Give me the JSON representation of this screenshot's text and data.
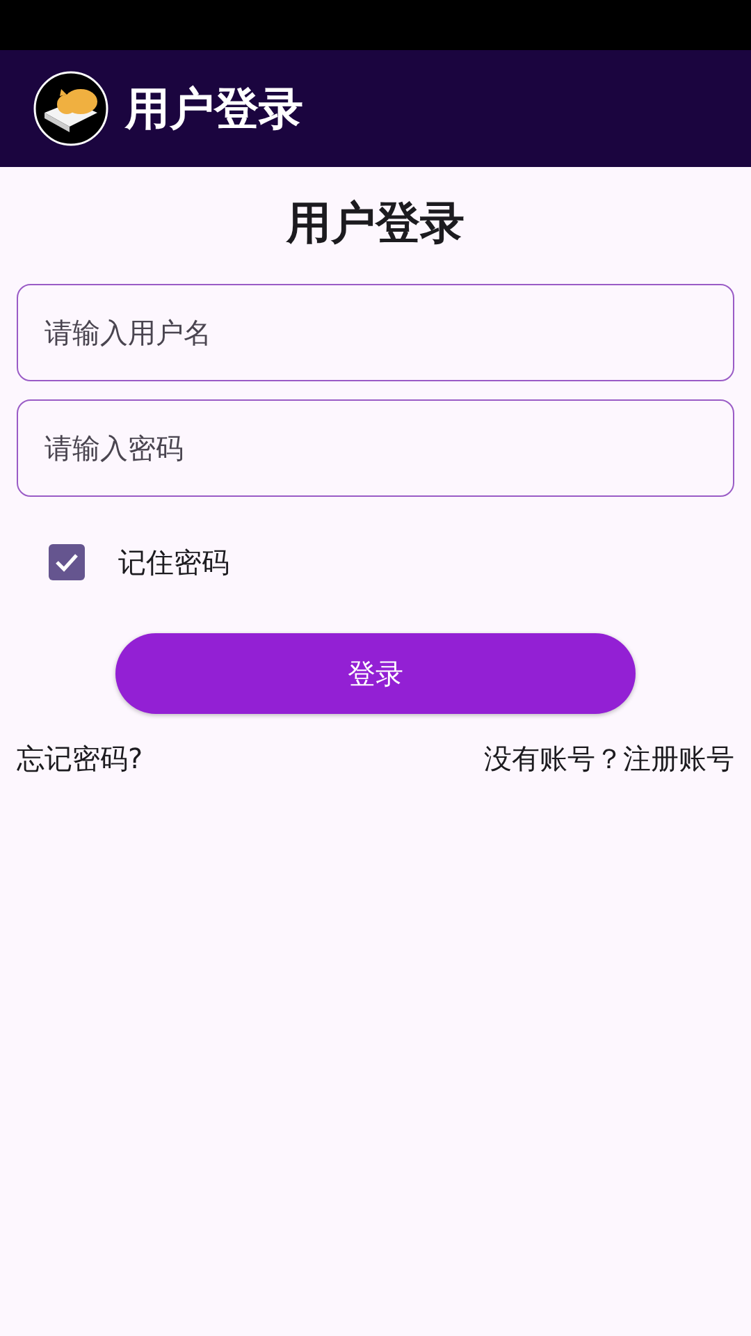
{
  "app_bar": {
    "title": "用户登录"
  },
  "heading": "用户登录",
  "username_field": {
    "placeholder": "请输入用户名"
  },
  "password_field": {
    "placeholder": "请输入密码"
  },
  "remember": {
    "label": "记住密码",
    "checked": true
  },
  "login_button": "登录",
  "forgot_link": "忘记密码?",
  "register_link": "没有账号？注册账号"
}
